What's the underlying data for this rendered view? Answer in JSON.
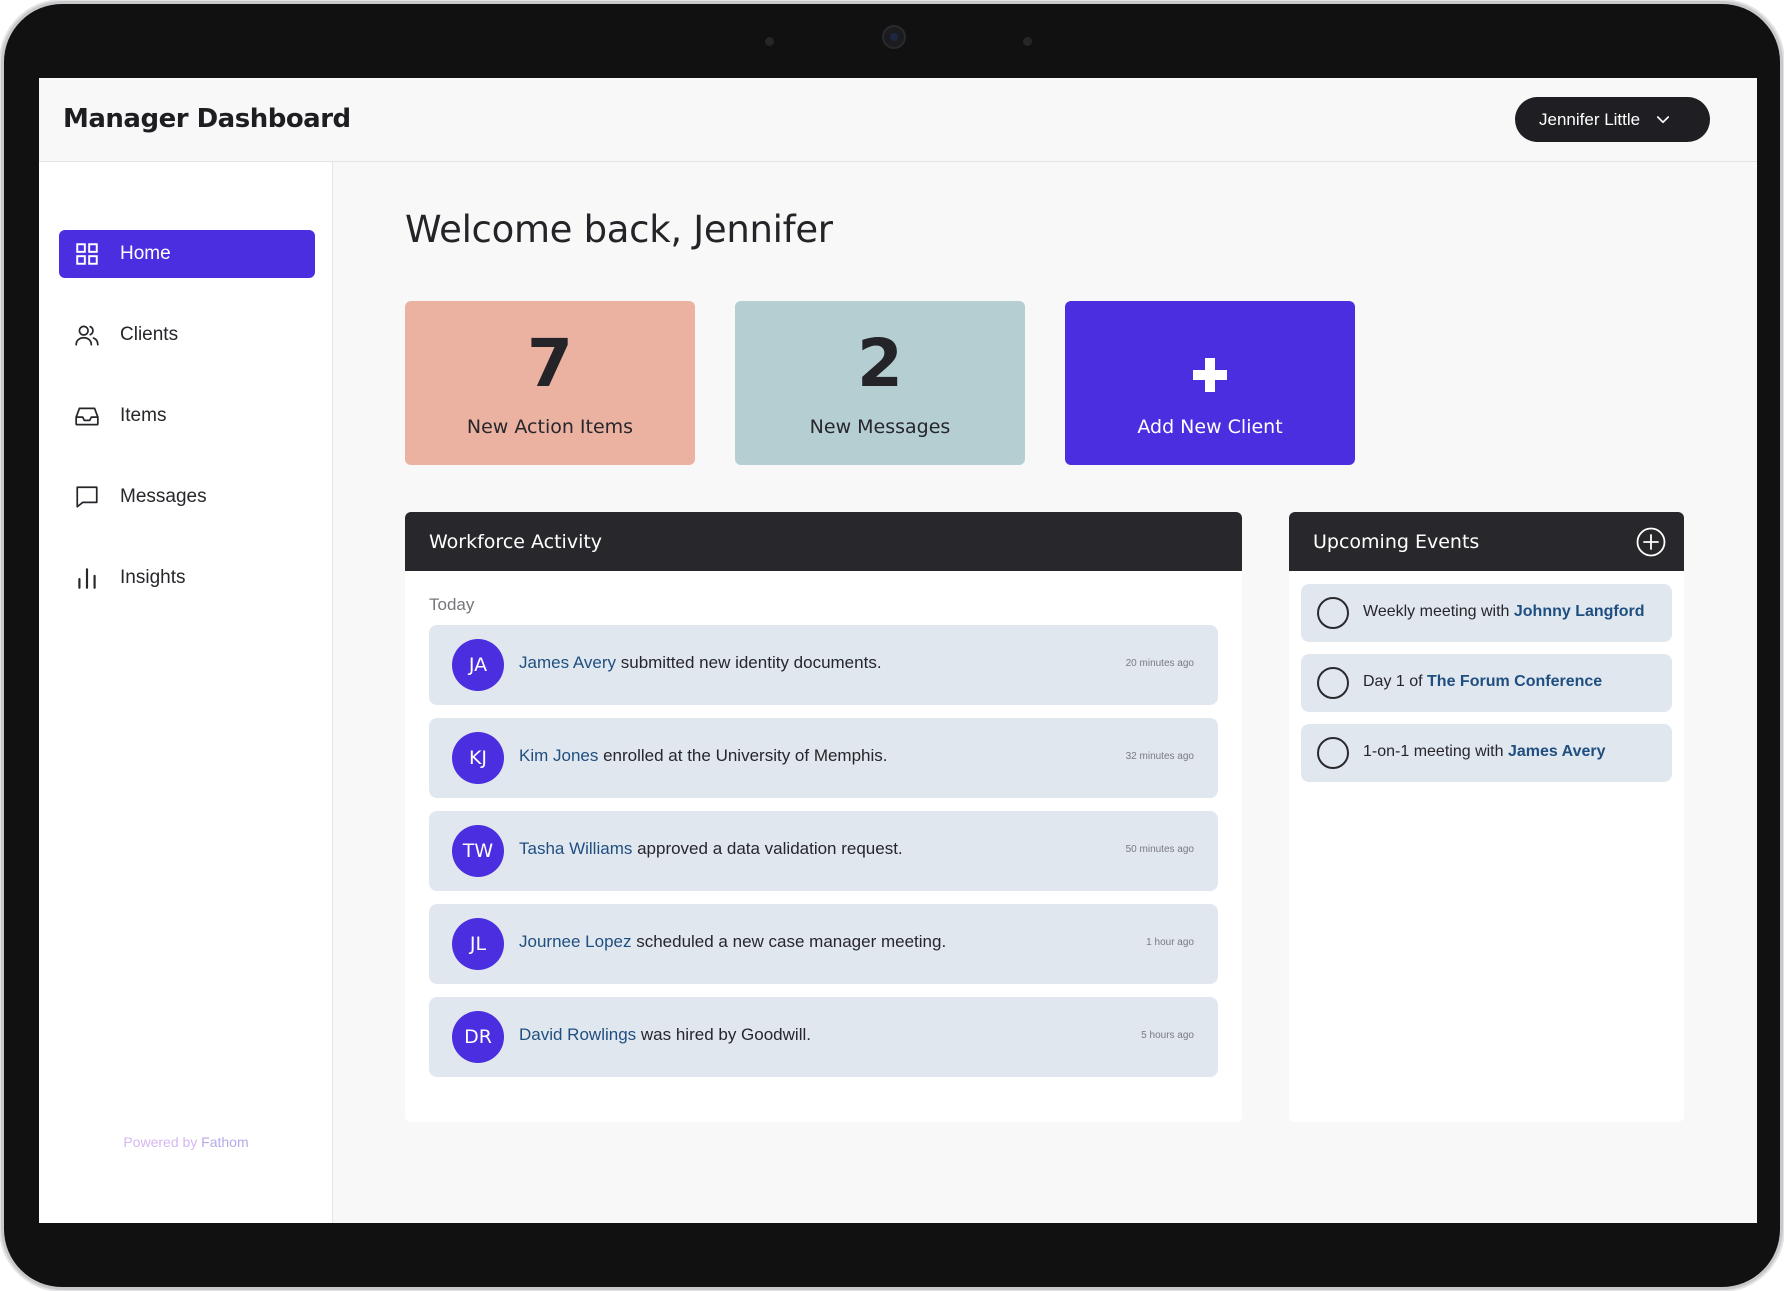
{
  "app": {
    "title": "Manager Dashboard"
  },
  "user": {
    "name": "Jennifer Little"
  },
  "sidebar": {
    "items": [
      {
        "label": "Home",
        "icon": "grid-icon",
        "active": true
      },
      {
        "label": "Clients",
        "icon": "users-icon"
      },
      {
        "label": "Items",
        "icon": "inbox-icon"
      },
      {
        "label": "Messages",
        "icon": "message-icon"
      },
      {
        "label": "Insights",
        "icon": "bar-chart-icon"
      }
    ],
    "powered_prefix": "Powered by",
    "powered_brand": "Fathom"
  },
  "main": {
    "welcome": "Welcome back, Jennifer",
    "cards": {
      "actions": {
        "value": "7",
        "label": "New Action Items",
        "color": "#ebb2a1"
      },
      "messages": {
        "value": "2",
        "label": "New Messages",
        "color": "#b5ced2"
      },
      "add_client": {
        "icon": "plus-icon",
        "label": "Add New Client",
        "color": "#4a2ee0"
      }
    }
  },
  "workforce": {
    "title": "Workforce Activity",
    "group_label": "Today",
    "items": [
      {
        "initials": "JA",
        "name": "James Avery",
        "text": " submitted new identity documents.",
        "time": "20 minutes ago"
      },
      {
        "initials": "KJ",
        "name": "Kim Jones",
        "text": " enrolled at the University of Memphis.",
        "time": "32 minutes ago"
      },
      {
        "initials": "TW",
        "name": "Tasha Williams",
        "text": " approved a data validation request.",
        "time": "50 minutes ago"
      },
      {
        "initials": "JL",
        "name": "Journee Lopez",
        "text": " scheduled a new case manager meeting.",
        "time": "1 hour ago"
      },
      {
        "initials": "DR",
        "name": "David Rowlings",
        "text": " was hired by Goodwill.",
        "time": "5 hours ago"
      }
    ]
  },
  "events": {
    "title": "Upcoming Events",
    "add_icon": "plus-circle-icon",
    "items": [
      {
        "prefix": "Weekly meeting with ",
        "highlight": "Johnny Langford"
      },
      {
        "prefix": "Day 1 of ",
        "highlight": "The Forum Conference"
      },
      {
        "prefix": "1-on-1 meeting with ",
        "highlight": "James Avery"
      }
    ]
  },
  "colors": {
    "accent": "#4a2ee0",
    "dark": "#28282c",
    "link": "#1f4f80",
    "row_bg": "#e1e7ef"
  }
}
